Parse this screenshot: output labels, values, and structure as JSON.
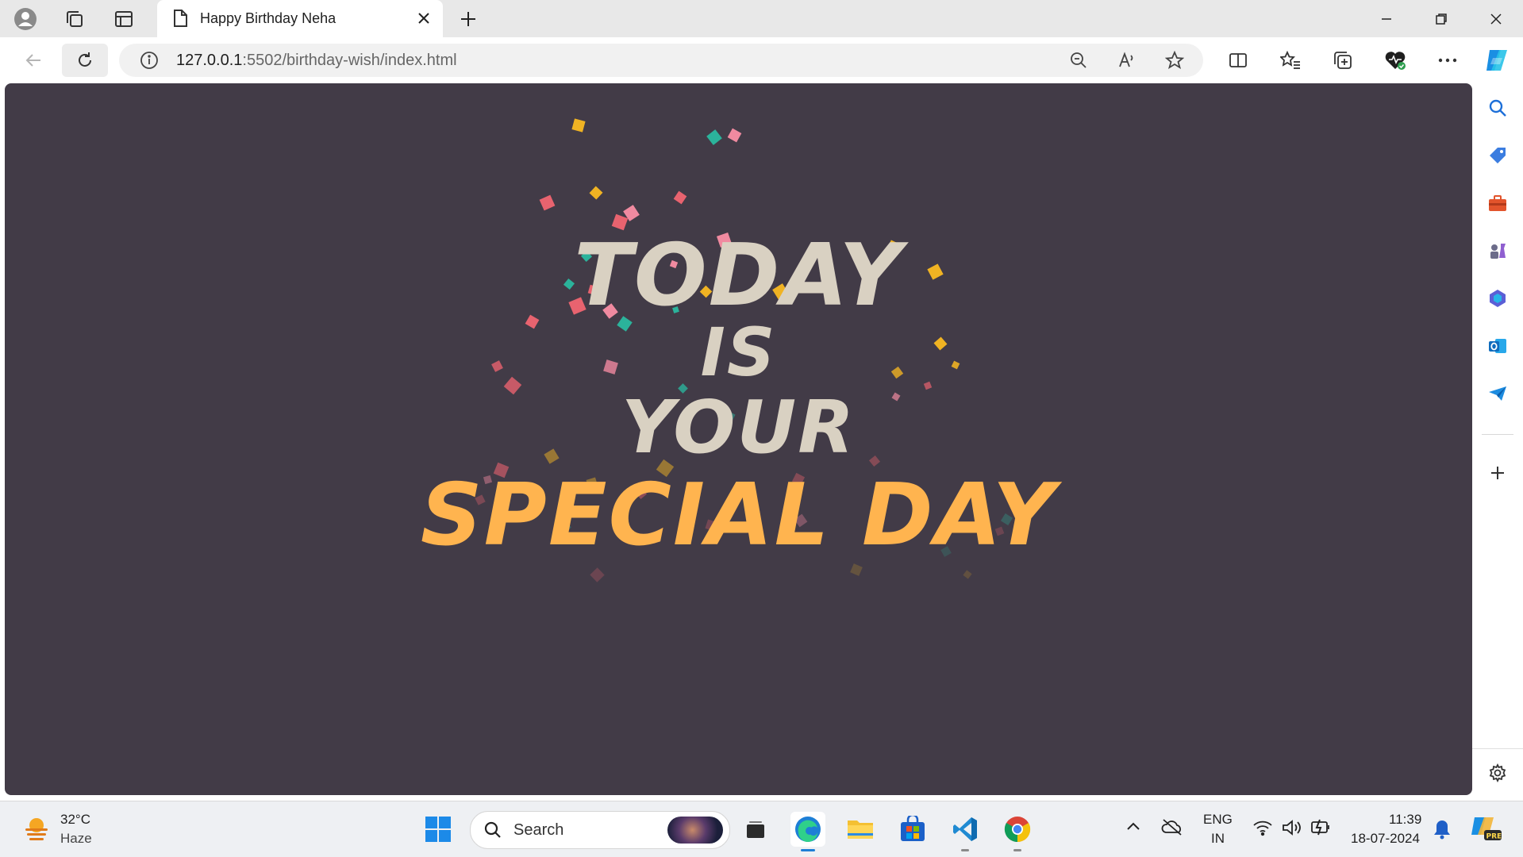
{
  "browser": {
    "tab": {
      "title": "Happy Birthday Neha"
    },
    "address": {
      "host": "127.0.0.1",
      "path": ":5502/birthday-wish/index.html"
    }
  },
  "page": {
    "background": "#423b47",
    "headline": {
      "line1": "TODAY",
      "line2": "IS",
      "line3": "YOUR",
      "line4": "SPECIAL DAY"
    },
    "colors": {
      "main_text": "#d9d1c2",
      "accent_text": "#ffb44f"
    },
    "confetti_colors": [
      "#e8636f",
      "#f0b323",
      "#2bb39b",
      "#f08aa0"
    ]
  },
  "taskbar": {
    "weather": {
      "temp": "32°C",
      "condition": "Haze"
    },
    "search_label": "Search",
    "language": {
      "line1": "ENG",
      "line2": "IN"
    },
    "clock": {
      "time": "11:39",
      "date": "18-07-2024"
    }
  }
}
